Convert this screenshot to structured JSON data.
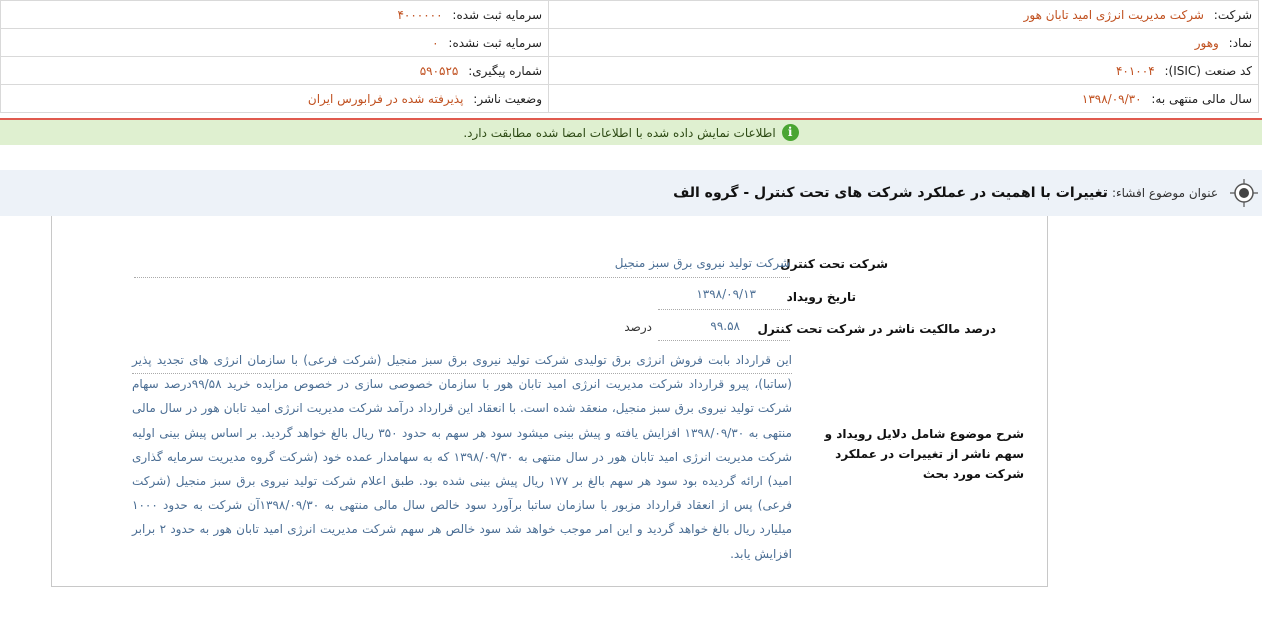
{
  "header": {
    "company_label": "شرکت:",
    "company_value": "شرکت مدیریت انرژی امید تابان هور",
    "registered_capital_label": "سرمایه ثبت شده:",
    "registered_capital_value": "۴۰۰۰۰۰۰",
    "symbol_label": "نماد:",
    "symbol_value": "وهور",
    "unregistered_capital_label": "سرمایه ثبت نشده:",
    "unregistered_capital_value": "۰",
    "isic_label": "کد صنعت (ISIC):",
    "isic_value": "۴۰۱۰۰۴",
    "tracking_label": "شماره پیگیری:",
    "tracking_value": "۵۹۰۵۲۵",
    "fiscal_year_label": "سال مالی منتهی به:",
    "fiscal_year_value": "۱۳۹۸/۰۹/۳۰",
    "publisher_status_label": "وضعیت ناشر:",
    "publisher_status_value": "پذیرفته شده در فرابورس ایران"
  },
  "notice": {
    "icon": "info-icon",
    "text": "اطلاعات نمایش داده شده با اطلاعات امضا شده مطابقت دارد."
  },
  "subject": {
    "prefix": "عنوان موضوع افشاء:",
    "title": "تغییرات با اهمیت در عملکرد شرکت های تحت کنترل - گروه الف"
  },
  "details": {
    "subsidiary_label": "شرکت تحت کنترل",
    "subsidiary_value": "شرکت تولید نیروی برق سبز منجیل",
    "event_date_label": "تاریخ رویداد",
    "event_date_value": "۱۳۹۸/۰۹/۱۳",
    "ownership_label": "درصد مالکیت ناشر در شرکت تحت کنترل",
    "ownership_value": "۹۹.۵۸",
    "ownership_unit": "درصد",
    "description_label": "شرح موضوع شامل دلایل رویداد و سهم ناشر از تغییرات در عملکرد شرکت مورد بحث",
    "description_text": "این قرارداد بابت فروش انرژی برق تولیدی شرکت تولید نیروی برق سبز منجیل (شرکت فرعی) با سازمان انرژی های تجدید پذیر (ساتبا)، پیرو قرارداد شرکت مدیریت انرژی امید تابان هور با سازمان خصوصی سازی در خصوص مزایده خرید ۹۹/۵۸درصد سهام شرکت تولید نیروی برق سبز منجیل، منعقد شده است. با انعقاد این قرارداد درآمد شرکت مدیریت انرژی امید تابان هور در سال مالی منتهی به ۱۳۹۸/۰۹/۳۰ افزایش یافته و پیش بینی میشود سود هر سهم به حدود ۳۵۰ ریال بالغ خواهد گردید. بر اساس پیش بینی اولیه شرکت مدیریت انرژی امید تابان هور در سال منتهی به ۱۳۹۸/۰۹/۳۰ که به سهامدار عمده خود (شرکت گروه مدیریت سرمایه گذاری امید) ارائه گردیده بود سود هر سهم بالغ بر ۱۷۷ ریال پیش بینی شده بود. طبق اعلام شرکت تولید نیروی برق سبز منجیل (شرکت فرعی) پس از انعقاد قرارداد مزبور با سازمان ساتبا برآورد سود خالص سال مالی منتهی به ۱۳۹۸/۰۹/۳۰آن شرکت به حدود ۱۰۰۰ میلیارد ریال بالغ خواهد گردید و این امر موجب خواهد شد سود خالص هر سهم شرکت مدیریت انرژی امید تابان هور به حدود ۲ برابر افزایش یابد."
  }
}
